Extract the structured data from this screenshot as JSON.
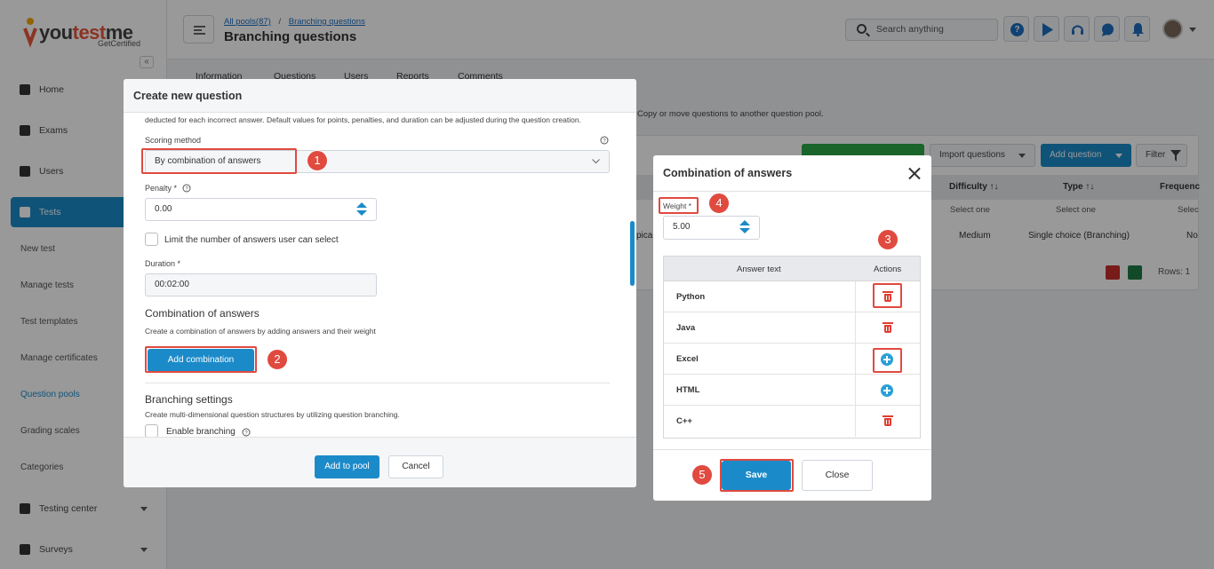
{
  "app": {
    "logo_text_1": "you",
    "logo_text_2": "test",
    "logo_text_3": "me",
    "logo_tagline": "GetCertified",
    "collapse_glyph": "«"
  },
  "sidebar": {
    "items": [
      {
        "label": "Home",
        "icon": "home-icon"
      },
      {
        "label": "Exams",
        "icon": "exams-icon"
      },
      {
        "label": "Users",
        "icon": "users-icon"
      },
      {
        "label": "Tests",
        "icon": "tests-icon",
        "active": true
      }
    ],
    "subitems": [
      "New test",
      "Manage tests",
      "Test templates",
      "Manage certificates",
      "Question pools",
      "Grading scales",
      "Categories"
    ],
    "selected_subitem": "Question pools",
    "bottom_items": [
      {
        "label": "Testing center",
        "icon": "testing-center-icon"
      },
      {
        "label": "Surveys",
        "icon": "surveys-icon"
      }
    ]
  },
  "header": {
    "breadcrumb_link_1": "All pools(87)",
    "breadcrumb_sep": "/",
    "breadcrumb_link_2": "Branching questions",
    "title": "Branching questions",
    "search_placeholder": "Search anything",
    "help_glyph": "?"
  },
  "page_tabs": [
    "Information",
    "Questions",
    "Users",
    "Reports",
    "Comments"
  ],
  "background": {
    "info_text": "Copy or move questions to another question pool.",
    "import_button": "Import questions",
    "add_question_button": "Add question",
    "filter_button": "Filter",
    "columns": [
      "Difficulty ↑↓",
      "Type ↑↓",
      "Frequenc"
    ],
    "filter_placeholders": [
      "Select one",
      "Select one",
      "Selec"
    ],
    "row_partial_text": "pica",
    "row_difficulty": "Medium",
    "row_type": "Single choice (Branching)",
    "row_frequency": "No",
    "rows_label": "Rows: 1"
  },
  "create_modal": {
    "title": "Create new question",
    "intro_text": "deducted for each incorrect answer. Default values for points, penalties, and duration can be adjusted during the question creation.",
    "scoring_label": "Scoring method",
    "scoring_value": "By combination of answers",
    "penalty_label": "Penalty *",
    "penalty_value": "0.00",
    "limit_label": "Limit the number of answers user can select",
    "duration_label": "Duration *",
    "duration_value": "00:02:00",
    "combination_heading": "Combination of answers",
    "combination_desc": "Create a combination of answers by adding answers and their weight",
    "add_combination_button": "Add combination",
    "branching_heading": "Branching settings",
    "branching_desc": "Create multi-dimensional question structures by utilizing question branching.",
    "enable_branching_label": "Enable branching",
    "add_to_pool_button": "Add to pool",
    "cancel_button": "Cancel"
  },
  "combination_modal": {
    "title": "Combination of answers",
    "weight_label": "Weight *",
    "weight_value": "5.00",
    "col_answer": "Answer text",
    "col_actions": "Actions",
    "answers": [
      {
        "text": "Python",
        "action": "delete"
      },
      {
        "text": "Java",
        "action": "delete"
      },
      {
        "text": "Excel",
        "action": "add"
      },
      {
        "text": "HTML",
        "action": "add"
      },
      {
        "text": "C++",
        "action": "delete"
      }
    ],
    "save_button": "Save",
    "close_button": "Close"
  },
  "callouts": [
    "1",
    "2",
    "3",
    "4",
    "5"
  ],
  "colors": {
    "accent": "#1b8ac9",
    "callout": "#e04a3f",
    "delete": "#e03e33",
    "add": "#2a9fd8"
  }
}
